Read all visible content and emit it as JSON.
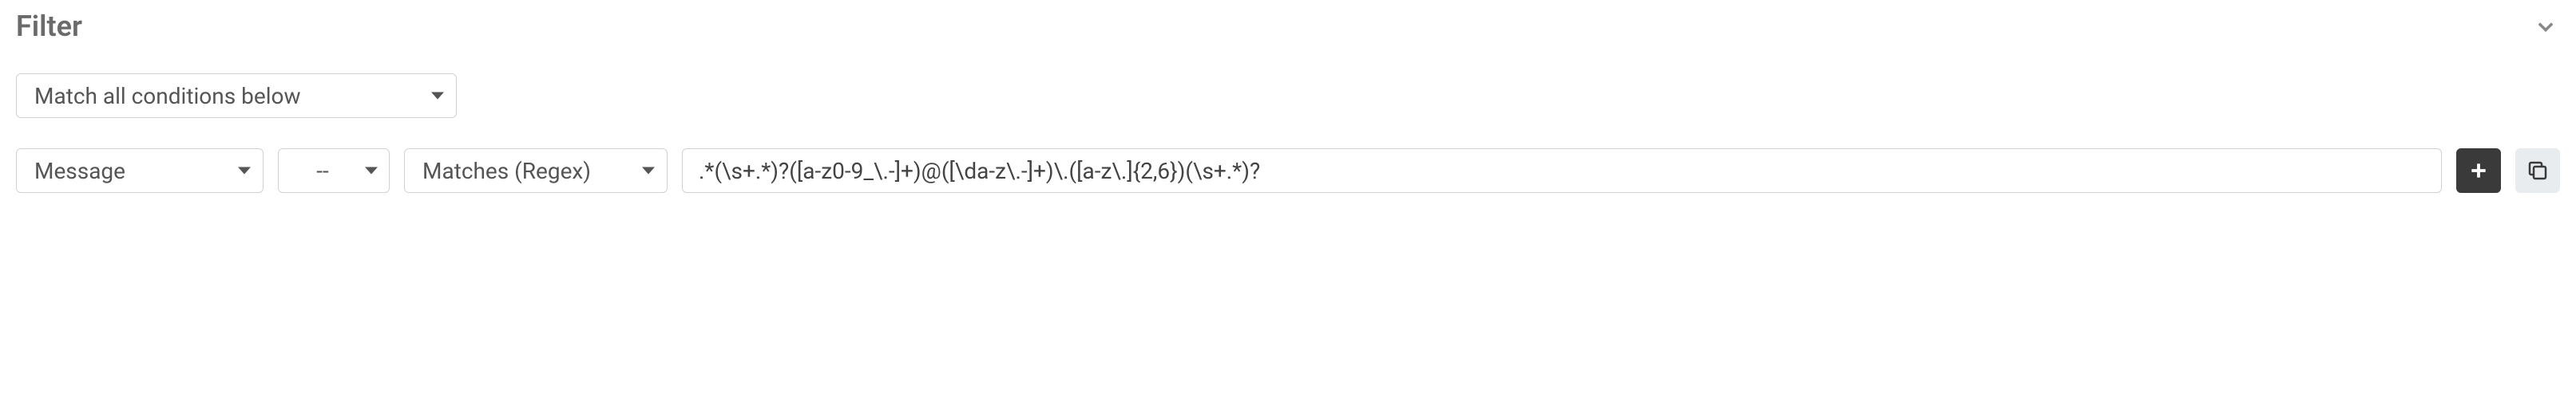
{
  "section": {
    "title": "Filter"
  },
  "match_mode": {
    "selected": "Match all conditions below"
  },
  "condition": {
    "field": "Message",
    "modifier": "--",
    "operator": "Matches (Regex)",
    "value": ".*(\\s+.*)?([a-z0-9_\\.-]+)@([\\da-z\\.-]+)\\.([a-z\\.]{2,6})(\\s+.*)?"
  }
}
